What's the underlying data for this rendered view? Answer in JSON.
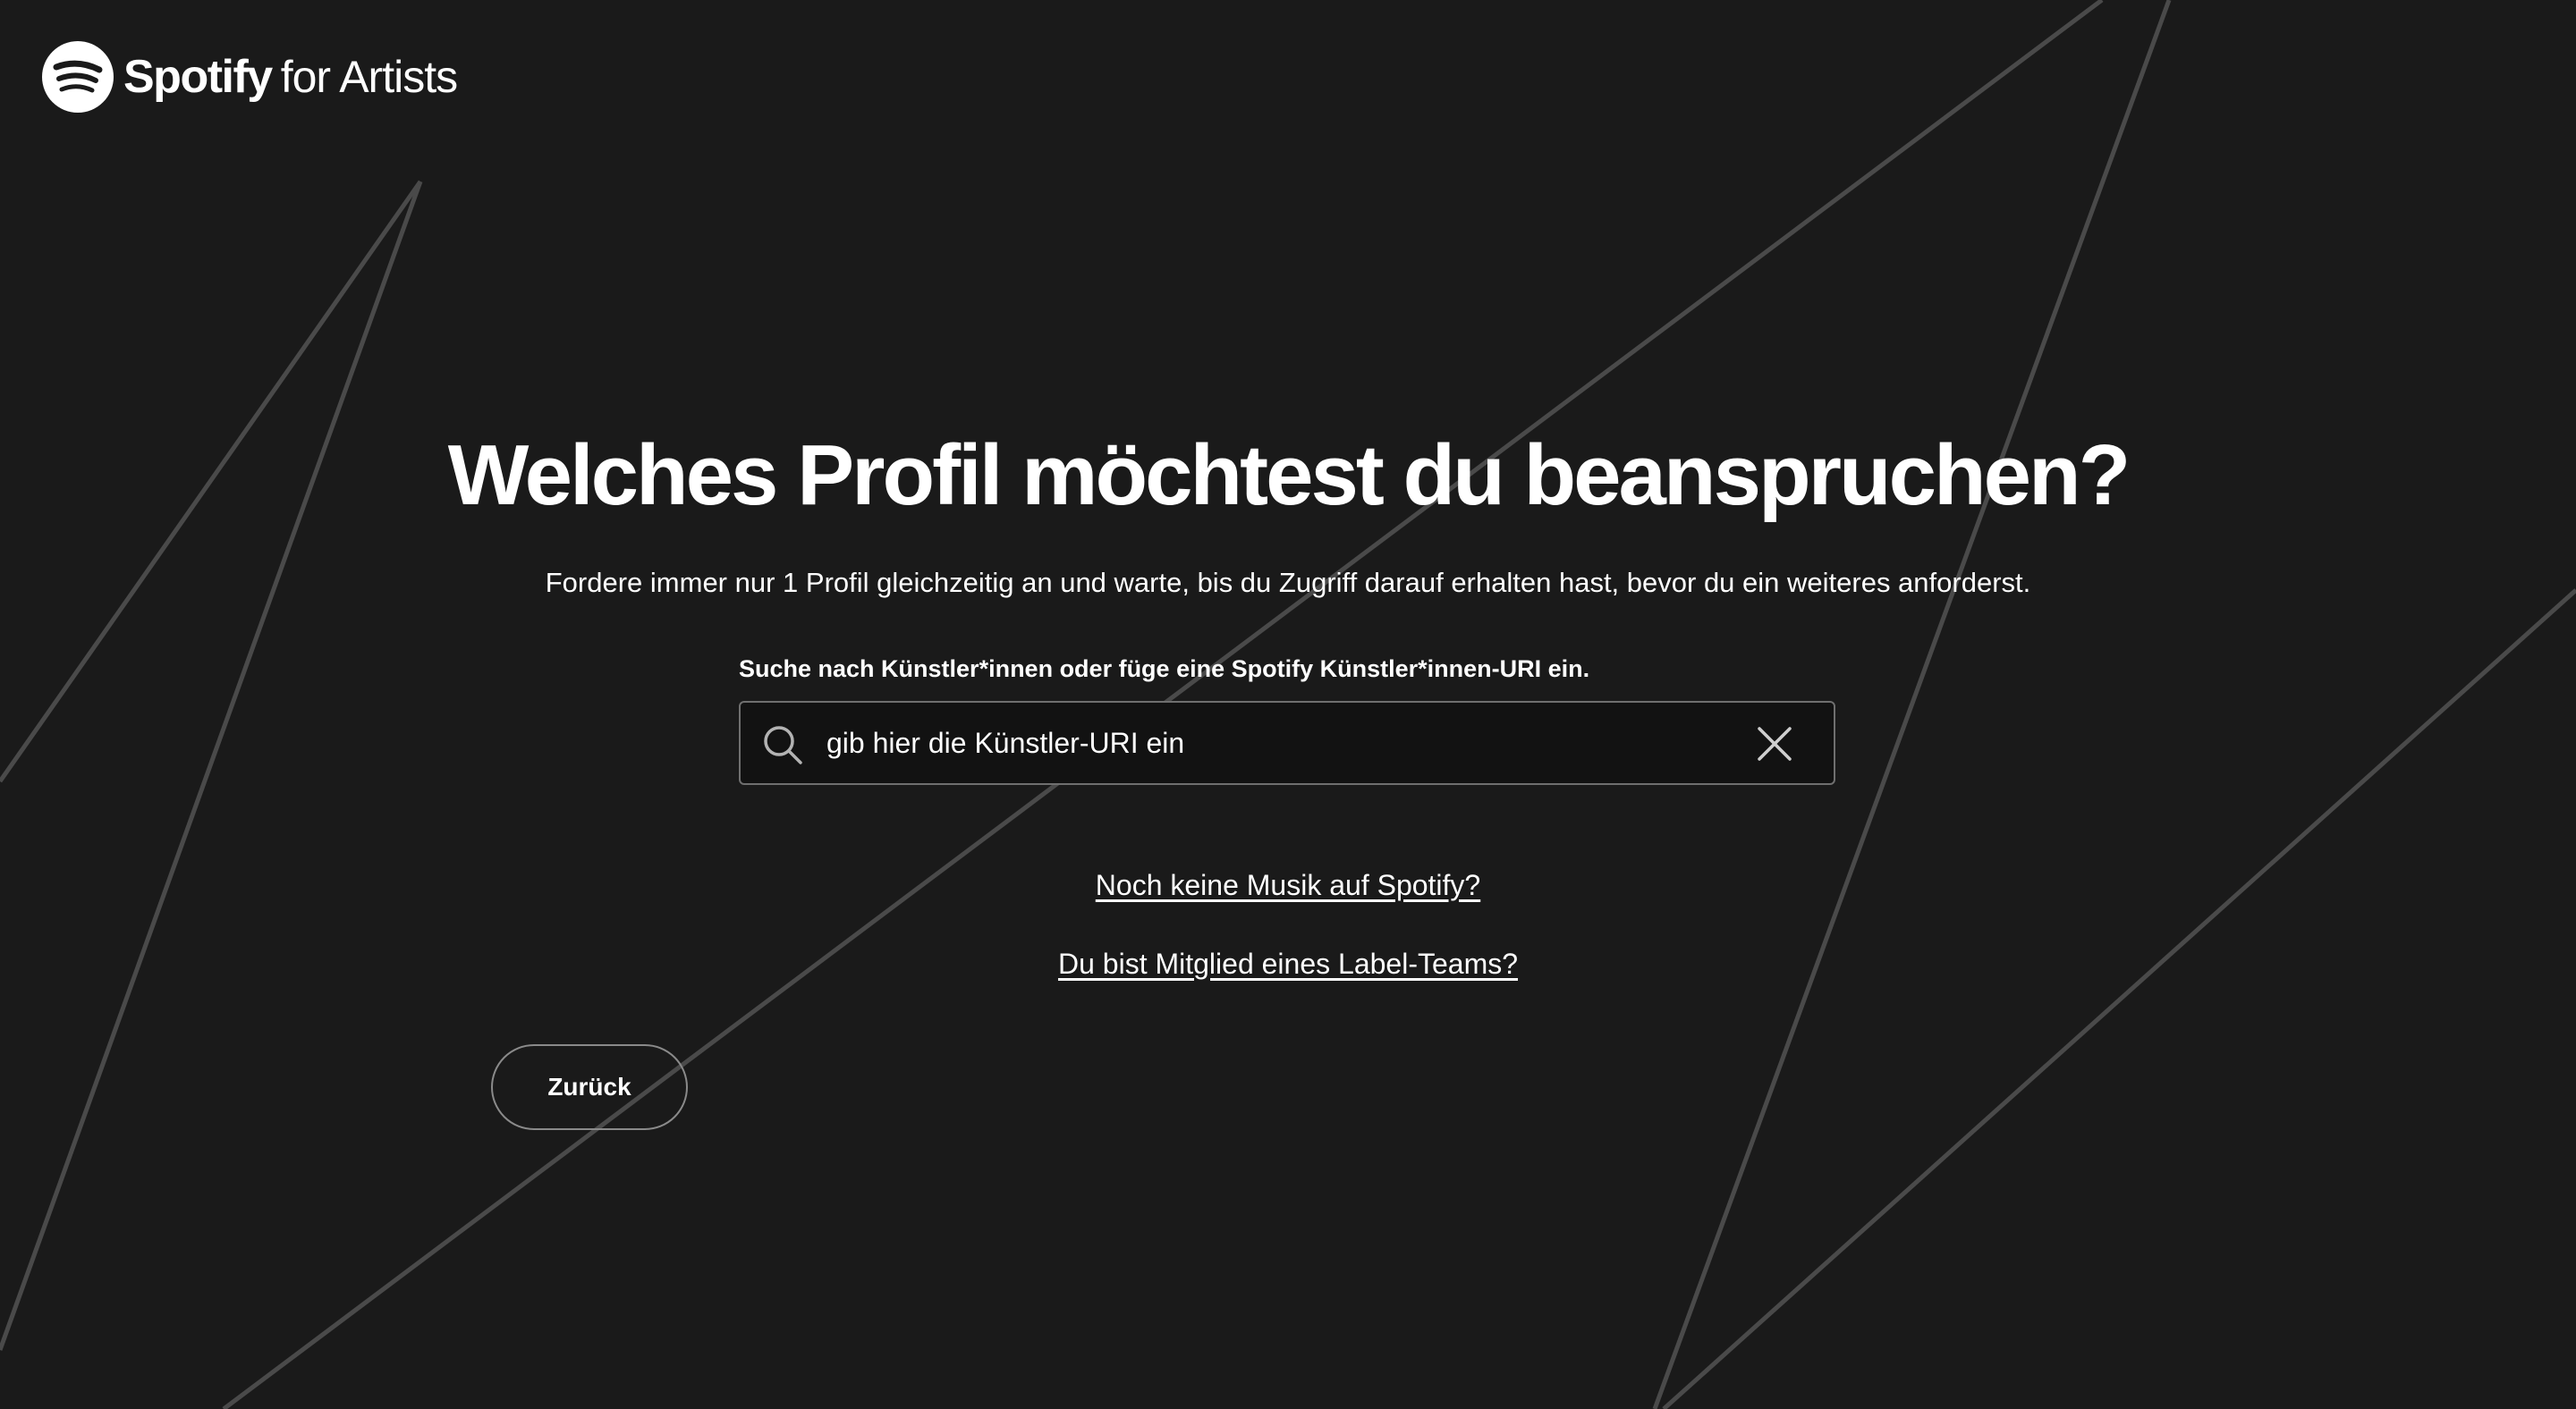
{
  "header": {
    "logo_wordmark": "Spotify",
    "logo_subtitle": "for Artists",
    "logo_icon": "spotify-logo-icon"
  },
  "main": {
    "title": "Welches Profil möchtest du beanspruchen?",
    "subtitle": "Fordere immer nur 1 Profil gleichzeitig an und warte, bis du Zugriff darauf erhalten hast, bevor du ein weiteres anforderst.",
    "search": {
      "label": "Suche nach Künstler*innen oder füge eine Spotify Künstler*innen-URI ein.",
      "value": "gib hier die Künstler-URI ein",
      "search_icon": "search-icon",
      "clear_icon": "close-icon"
    },
    "links": {
      "no_music": "Noch keine Musik auf Spotify?",
      "label_team": "Du bist Mitglied eines Label-Teams?"
    },
    "back_button": "Zurück"
  },
  "colors": {
    "background": "#1a1a1a",
    "decorative_lines": "#4a4a4a",
    "text": "#ffffff",
    "input_background": "#121212",
    "input_border": "#6f6f6f"
  }
}
